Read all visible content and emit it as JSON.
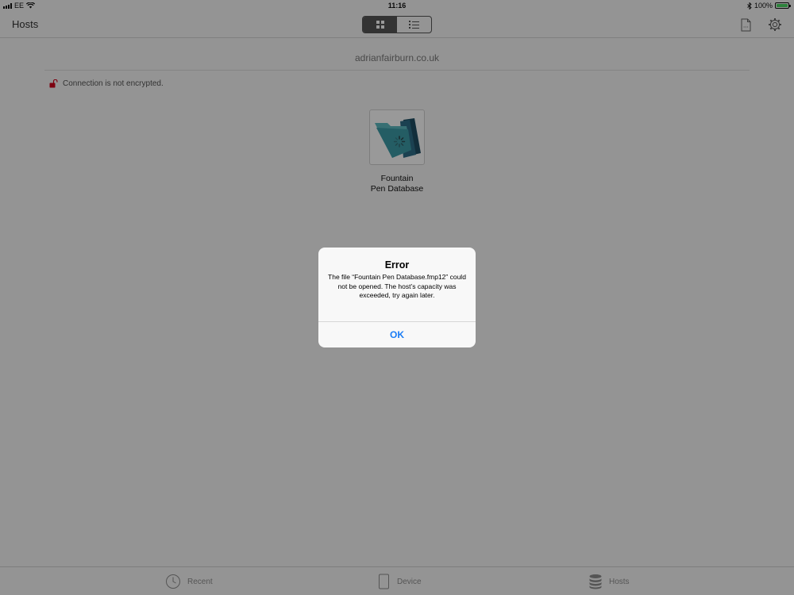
{
  "status_bar": {
    "carrier": "EE",
    "time": "11:16",
    "battery_percent": "100%",
    "battery_level": 1.0
  },
  "nav": {
    "title": "Hosts",
    "view_modes": [
      "grid",
      "list"
    ],
    "selected_view": "grid"
  },
  "host": {
    "name": "adrianfairburn.co.uk",
    "encryption_status": "Connection is not encrypted."
  },
  "files": [
    {
      "name_line1": "Fountain",
      "name_line2": "Pen Database"
    }
  ],
  "tabs": [
    {
      "label": "Recent",
      "icon": "clock-icon"
    },
    {
      "label": "Device",
      "icon": "device-icon"
    },
    {
      "label": "Hosts",
      "icon": "database-icon"
    }
  ],
  "alert": {
    "title": "Error",
    "message": "The file “Fountain Pen Database.fmp12” could not be opened. The host’s capacity was exceeded, try again later.",
    "ok_label": "OK"
  },
  "colors": {
    "accent": "#1a7cf5",
    "battery": "#4cd964",
    "lock": "#d0021b"
  }
}
